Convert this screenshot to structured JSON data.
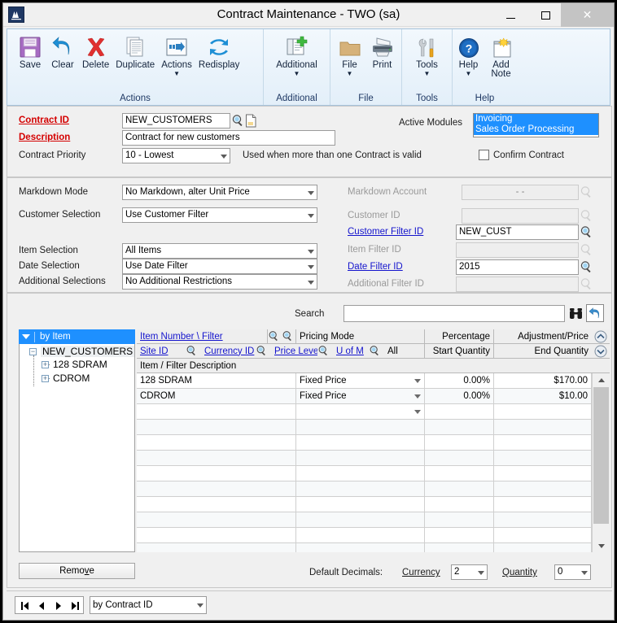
{
  "window": {
    "title": "Contract Maintenance  -  TWO (sa)",
    "app_icon": "dynamics-gp-icon",
    "minimize": "minimize-icon",
    "maximize": "maximize-icon",
    "close": "close-icon"
  },
  "ribbon": {
    "groups": [
      {
        "label": "Actions",
        "items": [
          {
            "label": "Save",
            "icon": "save-floppy-icon",
            "caret": false
          },
          {
            "label": "Clear",
            "icon": "clear-undo-arrow-icon",
            "caret": false
          },
          {
            "label": "Delete",
            "icon": "delete-x-icon",
            "caret": false
          },
          {
            "label": "Duplicate",
            "icon": "duplicate-pages-icon",
            "caret": false
          },
          {
            "label": "Actions",
            "icon": "actions-arrow-icon",
            "caret": true
          },
          {
            "label": "Redisplay",
            "icon": "redisplay-refresh-icon",
            "caret": false
          }
        ]
      },
      {
        "label": "Additional",
        "items": [
          {
            "label": "Additional",
            "icon": "additional-plus-icon",
            "caret": true
          }
        ]
      },
      {
        "label": "File",
        "items": [
          {
            "label": "File",
            "icon": "file-folder-icon",
            "caret": true
          },
          {
            "label": "Print",
            "icon": "printer-icon",
            "caret": false
          }
        ]
      },
      {
        "label": "Tools",
        "items": [
          {
            "label": "Tools",
            "icon": "tools-wrench-screwdriver-icon",
            "caret": true
          }
        ]
      },
      {
        "label": "Help",
        "items": [
          {
            "label": "Help",
            "icon": "help-question-icon",
            "caret": true
          },
          {
            "label": "Add\nNote",
            "icon": "add-note-icon",
            "caret": false
          }
        ]
      }
    ]
  },
  "header": {
    "contract_id_label": "Contract ID",
    "contract_id_value": "NEW_CUSTOMERS",
    "description_label": "Description",
    "description_value": "Contract for new customers",
    "contract_priority_label": "Contract Priority",
    "contract_priority_value": "10 - Lowest",
    "priority_hint": "Used when more than one Contract is valid",
    "active_modules_label": "Active Modules",
    "active_modules": [
      "Invoicing",
      "Sales Order Processing"
    ],
    "confirm_contract_label": "Confirm Contract",
    "confirm_contract_checked": false
  },
  "selections": {
    "markdown_mode_label": "Markdown Mode",
    "markdown_mode_value": "No Markdown, alter Unit Price",
    "customer_selection_label": "Customer Selection",
    "customer_selection_value": "Use Customer Filter",
    "item_selection_label": "Item Selection",
    "item_selection_value": "All Items",
    "date_selection_label": "Date Selection",
    "date_selection_value": "Use Date Filter",
    "additional_selections_label": "Additional Selections",
    "additional_selections_value": "No Additional Restrictions"
  },
  "filters": {
    "markdown_account_label": "Markdown Account",
    "markdown_account_value": "-            -",
    "customer_id_label": "Customer ID",
    "customer_id_value": "",
    "customer_filter_id_label": "Customer Filter ID",
    "customer_filter_id_value": "NEW_CUST",
    "item_filter_id_label": "Item Filter ID",
    "item_filter_id_value": "",
    "date_filter_id_label": "Date Filter ID",
    "date_filter_id_value": "2015",
    "additional_filter_id_label": "Additional Filter ID",
    "additional_filter_id_value": ""
  },
  "search": {
    "label": "Search",
    "value": "",
    "placeholder": "",
    "find_icon": "binoculars-find-icon",
    "reset_icon": "undo-reset-icon"
  },
  "tree": {
    "header": "by Item",
    "root": "NEW_CUSTOMERS",
    "children": [
      "128 SDRAM",
      "CDROM"
    ],
    "remove_button": "Remove"
  },
  "grid": {
    "headers_row1": [
      "Item Number \\ Filter",
      "Pricing Mode",
      "Percentage",
      "Adjustment/Price"
    ],
    "headers_row2": [
      "Site ID",
      "Currency ID",
      "Price Level",
      "U of M",
      "All",
      "Start Quantity",
      "End Quantity"
    ],
    "subheader": "Item / Filter Description",
    "scroll_up_icon": "scroll-up-icon",
    "scroll_down_icon": "scroll-down-icon",
    "rows": [
      {
        "item": "128 SDRAM",
        "pricing_mode": "Fixed Price",
        "percentage": "0.00%",
        "price": "$170.00"
      },
      {
        "item": "CDROM",
        "pricing_mode": "Fixed Price",
        "percentage": "0.00%",
        "price": "$10.00"
      },
      {
        "item": "",
        "pricing_mode": "",
        "percentage": "",
        "price": "",
        "has_caret": true
      },
      {
        "item": "",
        "pricing_mode": "",
        "percentage": "",
        "price": ""
      },
      {
        "item": "",
        "pricing_mode": "",
        "percentage": "",
        "price": ""
      },
      {
        "item": "",
        "pricing_mode": "",
        "percentage": "",
        "price": ""
      },
      {
        "item": "",
        "pricing_mode": "",
        "percentage": "",
        "price": ""
      },
      {
        "item": "",
        "pricing_mode": "",
        "percentage": "",
        "price": ""
      },
      {
        "item": "",
        "pricing_mode": "",
        "percentage": "",
        "price": ""
      },
      {
        "item": "",
        "pricing_mode": "",
        "percentage": "",
        "price": ""
      },
      {
        "item": "",
        "pricing_mode": "",
        "percentage": "",
        "price": ""
      },
      {
        "item": "",
        "pricing_mode": "",
        "percentage": "",
        "price": ""
      }
    ]
  },
  "footer": {
    "default_decimals_label": "Default Decimals:",
    "currency_label": "Currency",
    "currency_value": "2",
    "quantity_label": "Quantity",
    "quantity_value": "0",
    "nav_first": "first-record-icon",
    "nav_prev": "previous-record-icon",
    "nav_next": "next-record-icon",
    "nav_last": "last-record-icon",
    "sort_value": "by Contract ID"
  },
  "colors": {
    "accent": "#1e90ff",
    "required": "#d40000",
    "link": "#1414cd",
    "ribbon_label": "#1f3864"
  }
}
